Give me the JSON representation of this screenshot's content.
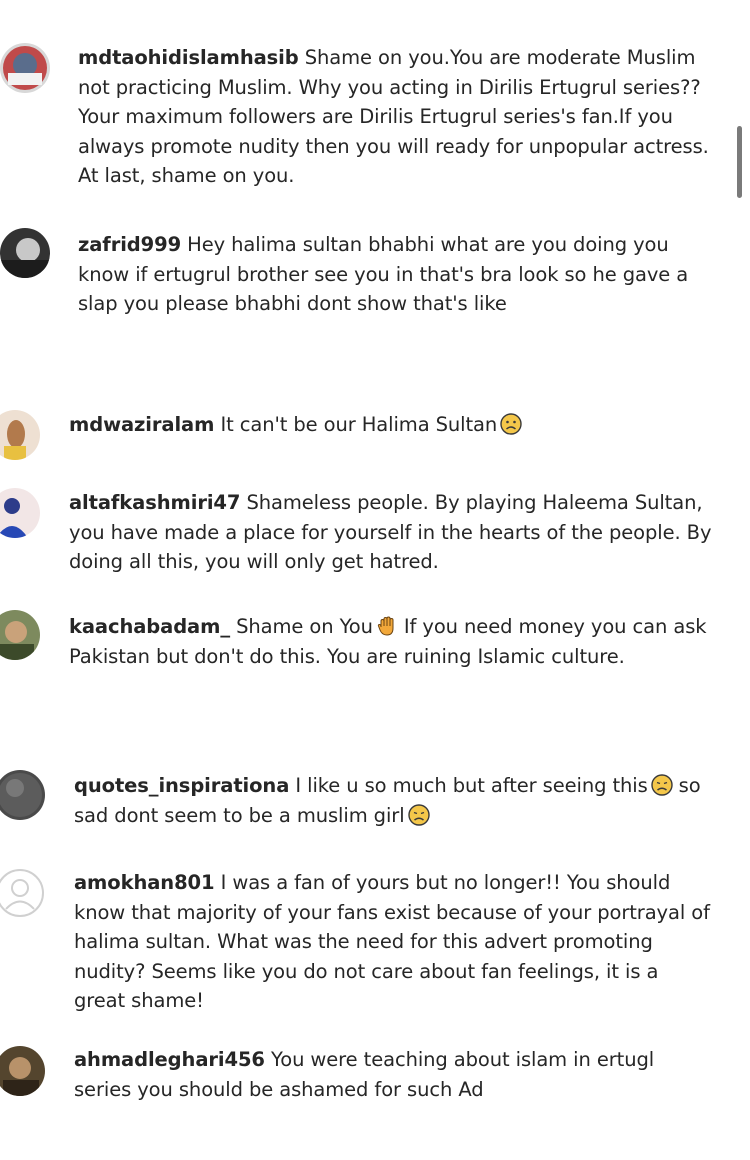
{
  "comments": [
    {
      "username": "mdtaohidislamhasib",
      "text": "Shame on you.You are moderate Muslim not practicing Muslim. Why you acting in Dirilis Ertugrul series?? Your maximum followers are Dirilis Ertugrul series's fan.If you always promote nudity then you will ready for unpopular actress. At last, shame on you."
    },
    {
      "username": "zafrid999",
      "text": "Hey halima sultan bhabhi what are you doing you know if ertugrul brother see you in that's bra look so he gave a slap you please bhabhi dont show that's like"
    },
    {
      "username": "mdwaziralam",
      "text": "It can't be our Halima Sultan",
      "emoji": "frowning-face"
    },
    {
      "username": "altafkashmiri47",
      "text": "Shameless people. By playing Haleema Sultan, you have made a place for yourself in the hearts of the people. By doing all this, you will only get hatred."
    },
    {
      "username": "kaachabadam_",
      "text_before": "Shame on You",
      "emoji": "raised-hand",
      "text_after": "If you need money you can ask Pakistan but don't do this. You are ruining Islamic culture."
    },
    {
      "username": "quotes_inspirationa",
      "text_before": "I like u so much but after seeing this",
      "emoji": "disappointed-face",
      "text_after": "so sad dont seem to be a muslim girl",
      "emoji_end": "disappointed-face"
    },
    {
      "username": "amokhan801",
      "text": "I was a fan of yours but no longer!! You should know that majority of your fans exist because of your portrayal of halima sultan. What was the need for this advert promoting nudity? Seems like you do not care about fan feelings, it is a great shame!"
    },
    {
      "username": "ahmadleghari456",
      "text": "You were teaching about islam in ertugl series you should be ashamed for such Ad"
    }
  ],
  "colors": {
    "background": "#ffffff",
    "text": "#262626",
    "scrollbar": "#7a7a7a"
  }
}
